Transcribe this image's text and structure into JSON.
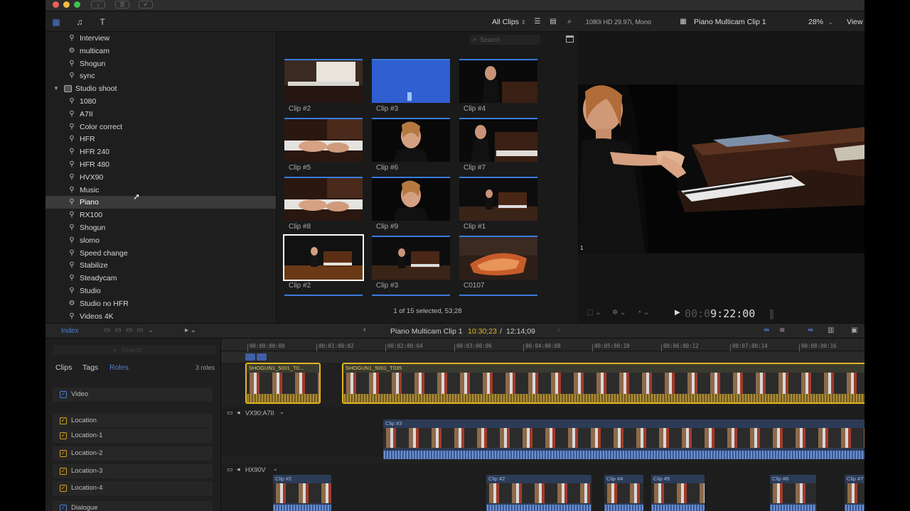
{
  "colors": {
    "accent": "#3b7bdc",
    "clip_yellow": "#e0b51f",
    "clip_blue": "#2c3b56",
    "selection": "#3a3a3a"
  },
  "toolbar": {
    "filter": "All Clips",
    "format": "1080i HD 29.97i, Mono",
    "viewer_title": "Piano Multicam Clip 1",
    "zoom": "28%",
    "view_label": "View",
    "search_placeholder": "Search"
  },
  "sidebar": {
    "items": [
      {
        "label": "Interview",
        "icon": "keyword-icon",
        "indent": 1
      },
      {
        "label": "multicam",
        "icon": "smart-collection-icon",
        "indent": 1
      },
      {
        "label": "Shogun",
        "icon": "keyword-icon",
        "indent": 1
      },
      {
        "label": "sync",
        "icon": "keyword-icon",
        "indent": 1
      },
      {
        "label": "Studio shoot",
        "icon": "event-icon",
        "indent": 0
      },
      {
        "label": "1080",
        "icon": "keyword-icon",
        "indent": 1
      },
      {
        "label": "A7II",
        "icon": "keyword-icon",
        "indent": 1
      },
      {
        "label": "Color correct",
        "icon": "keyword-icon",
        "indent": 1
      },
      {
        "label": "HFR",
        "icon": "keyword-icon",
        "indent": 1
      },
      {
        "label": "HFR 240",
        "icon": "keyword-icon",
        "indent": 1
      },
      {
        "label": "HFR 480",
        "icon": "keyword-icon",
        "indent": 1
      },
      {
        "label": "HVX90",
        "icon": "keyword-icon",
        "indent": 1
      },
      {
        "label": "Music",
        "icon": "keyword-icon",
        "indent": 1
      },
      {
        "label": "Piano",
        "icon": "keyword-icon",
        "indent": 1
      },
      {
        "label": "RX100",
        "icon": "keyword-icon",
        "indent": 1
      },
      {
        "label": "Shogun",
        "icon": "keyword-icon",
        "indent": 1
      },
      {
        "label": "slomo",
        "icon": "keyword-icon",
        "indent": 1
      },
      {
        "label": "Speed change",
        "icon": "keyword-icon",
        "indent": 1
      },
      {
        "label": "Stabilize",
        "icon": "keyword-icon",
        "indent": 1
      },
      {
        "label": "Steadycam",
        "icon": "keyword-icon",
        "indent": 1
      },
      {
        "label": "Studio",
        "icon": "keyword-icon",
        "indent": 1
      },
      {
        "label": "Studio no HFR",
        "icon": "smart-collection-icon",
        "indent": 1
      },
      {
        "label": "Videos 4K",
        "icon": "keyword-icon",
        "indent": 1
      }
    ]
  },
  "browser": {
    "clips": [
      {
        "label": "Clip #2",
        "scene": "sheet"
      },
      {
        "label": "Clip #3",
        "scene": "blue"
      },
      {
        "label": "Clip #4",
        "scene": "girl-side"
      },
      {
        "label": "Clip #5",
        "scene": "hands"
      },
      {
        "label": "Clip #6",
        "scene": "face"
      },
      {
        "label": "Clip #7",
        "scene": "girl-keys"
      },
      {
        "label": "Clip #8",
        "scene": "hands"
      },
      {
        "label": "Clip #9",
        "scene": "face"
      },
      {
        "label": "Clip #1",
        "scene": "wide"
      },
      {
        "label": "Clip #2",
        "scene": "wide-warm"
      },
      {
        "label": "Clip #3",
        "scene": "wide"
      },
      {
        "label": "C0107",
        "scene": "piano-top"
      }
    ],
    "status": "1 of 15 selected, 53;28"
  },
  "viewer": {
    "angle_number": "1",
    "timecode_dim": "00:0",
    "timecode": "9:22:00"
  },
  "timeline_bar": {
    "index_label": "Index",
    "title": "Piano Multicam Clip 1",
    "position": "10:30;23",
    "duration": "12:14;09"
  },
  "index_panel": {
    "tabs": [
      "Clips",
      "Tags",
      "Roles"
    ],
    "count": "3 roles",
    "roles": [
      {
        "label": "Video",
        "color": "blue"
      },
      {
        "label": "Location",
        "color": "yellow"
      },
      {
        "label": "Location-1",
        "color": "yellow"
      },
      {
        "label": "Location-2",
        "color": "yellow"
      },
      {
        "label": "Location-3",
        "color": "yellow"
      },
      {
        "label": "Location-4",
        "color": "yellow"
      },
      {
        "label": "Dialogue",
        "color": "blue"
      }
    ]
  },
  "timeline": {
    "ruler": [
      "00:00:00:00",
      "00:01:00:02",
      "00:02:00:04",
      "00:03:00:06",
      "00:04:00:08",
      "00:05:00:10",
      "00:06:00:12",
      "00:07:00:14",
      "00:08:00:16"
    ],
    "primary_clips": [
      "SHOGUN1_5001_T0...",
      "SHOGUN1_5001_T035"
    ],
    "angle_a": "VX90:A7II",
    "angle_a_clip": "Clip #3",
    "angle_b": "HX90V",
    "angle_b_clips": [
      "Clip #2",
      "Clip #2",
      "Clip #4",
      "Clip #5",
      "Clip #6",
      "Clip #7"
    ]
  }
}
